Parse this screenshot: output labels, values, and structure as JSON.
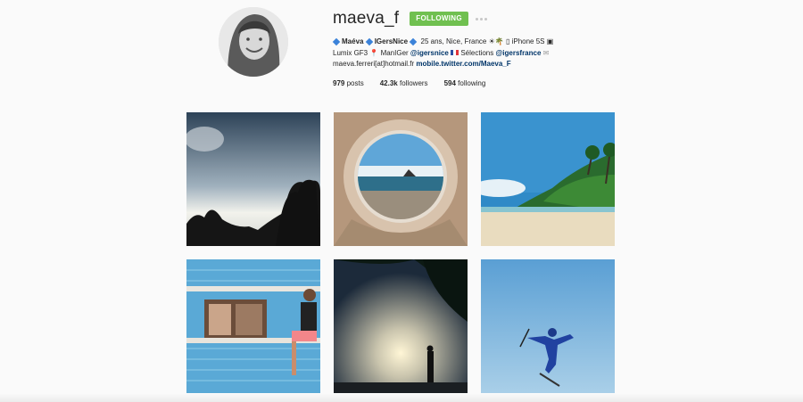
{
  "profile": {
    "username": "maeva_f",
    "follow_button": "FOLLOWING",
    "bio": {
      "name": "Maéva",
      "group": "IGersNice",
      "age_location": "25 ans, Nice, France",
      "device": "iPhone 5S",
      "camera": "Lumix GF3",
      "manager": "ManIGer",
      "manager_handle": "@igersnice",
      "selections": "Sélections",
      "selections_handle": "@igersfrance",
      "email": "maeva.ferreri[at]hotmail.fr",
      "website": "mobile.twitter.com/Maeva_F"
    },
    "stats": {
      "posts_count": "979",
      "posts_label": "posts",
      "followers_count": "42.3k",
      "followers_label": "followers",
      "following_count": "594",
      "following_label": "following"
    }
  },
  "colors": {
    "follow_green": "#70c050",
    "link_blue": "#003569",
    "background": "#fafafa"
  },
  "posts": [
    {
      "name": "post-sunset-silhouette-trees"
    },
    {
      "name": "post-circular-window-beach"
    },
    {
      "name": "post-palm-beach"
    },
    {
      "name": "post-man-blue-wall"
    },
    {
      "name": "post-palm-silhouette-sunset"
    },
    {
      "name": "post-skier-jump"
    }
  ]
}
